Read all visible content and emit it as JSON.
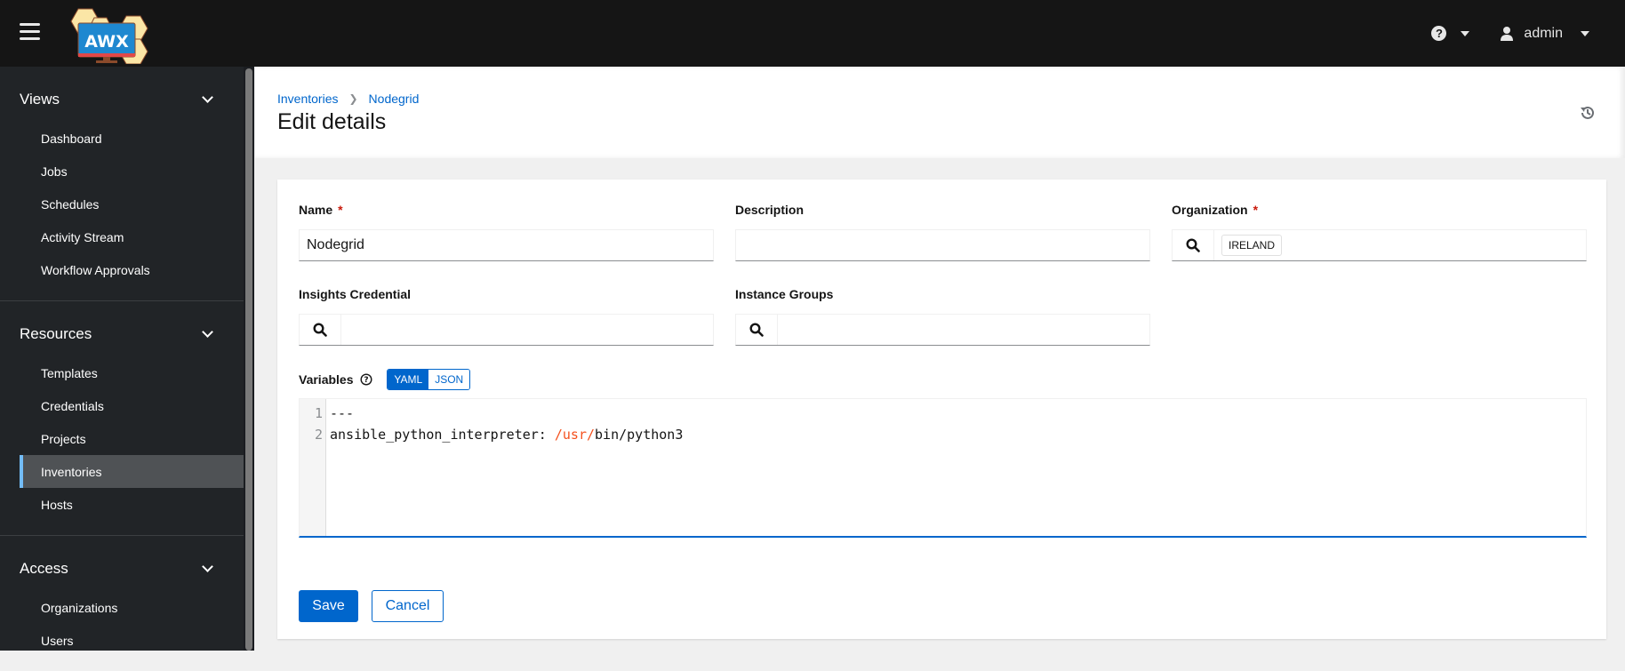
{
  "header": {
    "logo_text": "AWX",
    "help_icon": "question-circle-icon",
    "user_icon": "user-icon",
    "username": "admin"
  },
  "sidebar": {
    "sections": [
      {
        "title": "Views",
        "items": [
          "Dashboard",
          "Jobs",
          "Schedules",
          "Activity Stream",
          "Workflow Approvals"
        ]
      },
      {
        "title": "Resources",
        "items": [
          "Templates",
          "Credentials",
          "Projects",
          "Inventories",
          "Hosts"
        ]
      },
      {
        "title": "Access",
        "items": [
          "Organizations",
          "Users"
        ]
      }
    ],
    "active_item": "Inventories"
  },
  "page": {
    "breadcrumb": [
      "Inventories",
      "Nodegrid"
    ],
    "title": "Edit details"
  },
  "form": {
    "name": {
      "label": "Name",
      "required": "*",
      "value": "Nodegrid"
    },
    "description": {
      "label": "Description",
      "value": ""
    },
    "organization": {
      "label": "Organization",
      "required": "*",
      "chip": "IRELAND"
    },
    "insights_credential": {
      "label": "Insights Credential",
      "value": ""
    },
    "instance_groups": {
      "label": "Instance Groups",
      "value": ""
    },
    "variables": {
      "label": "Variables",
      "modes": [
        "YAML",
        "JSON"
      ],
      "active_mode": "YAML",
      "lines": [
        {
          "num": "1",
          "text": "---"
        },
        {
          "num": "2",
          "key": "ansible_python_interpreter: ",
          "path": "/usr/",
          "rest": "bin/python3"
        }
      ]
    },
    "save_label": "Save",
    "cancel_label": "Cancel"
  },
  "colors": {
    "accent": "#0066cc",
    "masthead": "#151515",
    "sidebar": "#212427",
    "active_border": "#73bcf7",
    "required": "#c9190b",
    "yaml_path": "#f4511e"
  }
}
